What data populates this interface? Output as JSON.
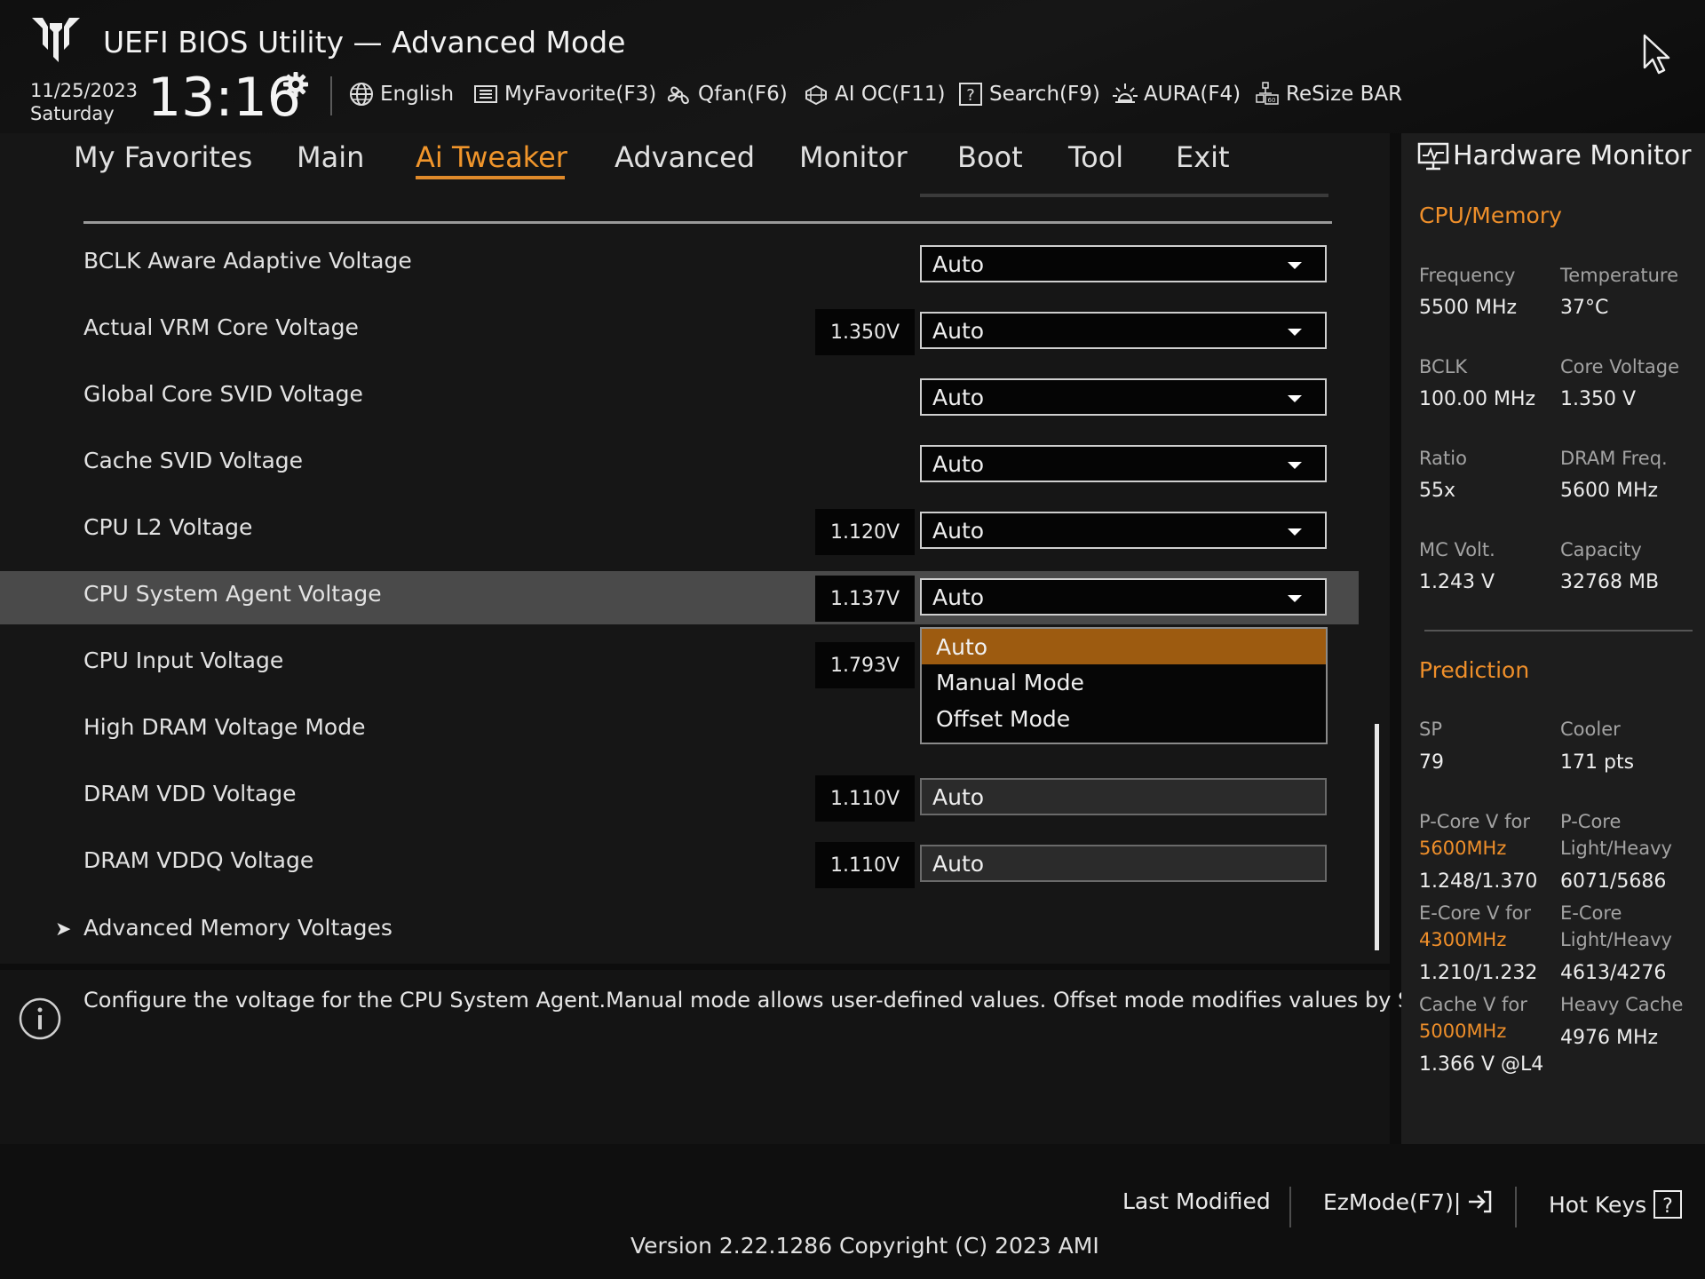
{
  "header": {
    "title": "UEFI BIOS Utility — Advanced Mode",
    "date": "11/25/2023",
    "day": "Saturday",
    "time": "13:16",
    "toolbar": {
      "language": "English",
      "my_favorite": "MyFavorite(F3)",
      "qfan": "Qfan(F6)",
      "ai_oc": "AI OC(F11)",
      "search": "Search(F9)",
      "aura": "AURA(F4)",
      "resize_bar": "ReSize BAR"
    }
  },
  "nav": {
    "tabs": [
      "My Favorites",
      "Main",
      "Ai Tweaker",
      "Advanced",
      "Monitor",
      "Boot",
      "Tool",
      "Exit"
    ],
    "active": "Ai Tweaker"
  },
  "settings": [
    {
      "label": "BCLK Aware Adaptive Voltage",
      "voltage": "",
      "value": "Auto"
    },
    {
      "label": "Actual VRM Core Voltage",
      "voltage": "1.350V",
      "value": "Auto"
    },
    {
      "label": "Global Core SVID Voltage",
      "voltage": "",
      "value": "Auto"
    },
    {
      "label": "Cache SVID Voltage",
      "voltage": "",
      "value": "Auto"
    },
    {
      "label": "CPU L2 Voltage",
      "voltage": "1.120V",
      "value": "Auto"
    },
    {
      "label": "CPU System Agent Voltage",
      "voltage": "1.137V",
      "value": "Auto"
    },
    {
      "label": "CPU Input Voltage",
      "voltage": "1.793V",
      "value": ""
    },
    {
      "label": "High DRAM Voltage Mode",
      "voltage": "",
      "value": ""
    },
    {
      "label": "DRAM VDD Voltage",
      "voltage": "1.110V",
      "value": "Auto"
    },
    {
      "label": "DRAM VDDQ Voltage",
      "voltage": "1.110V",
      "value": "Auto"
    },
    {
      "label": "Advanced Memory Voltages",
      "voltage": "",
      "value": ""
    }
  ],
  "dropdown": {
    "options": [
      "Auto",
      "Manual Mode",
      "Offset Mode"
    ],
    "selected": "Auto"
  },
  "help_text": "Configure the voltage for the CPU System Agent.Manual mode allows user-defined values. Offset mode modifies values by SVID.",
  "hardware_monitor": {
    "title": "Hardware Monitor",
    "cpu_memory": {
      "section": "CPU/Memory",
      "frequency_label": "Frequency",
      "frequency": "5500 MHz",
      "temperature_label": "Temperature",
      "temperature": "37°C",
      "bclk_label": "BCLK",
      "bclk": "100.00 MHz",
      "core_voltage_label": "Core Voltage",
      "core_voltage": "1.350 V",
      "ratio_label": "Ratio",
      "ratio": "55x",
      "dram_freq_label": "DRAM Freq.",
      "dram_freq": "5600 MHz",
      "mc_volt_label": "MC Volt.",
      "mc_volt": "1.243 V",
      "capacity_label": "Capacity",
      "capacity": "32768 MB"
    },
    "prediction": {
      "section": "Prediction",
      "sp_label": "SP",
      "sp": "79",
      "cooler_label": "Cooler",
      "cooler": "171 pts",
      "pcore_v_label": "P-Core V for",
      "pcore_v_freq": "5600MHz",
      "pcore_v": "1.248/1.370",
      "pcore_lh_label1": "P-Core",
      "pcore_lh_label2": "Light/Heavy",
      "pcore_lh": "6071/5686",
      "ecore_v_label": "E-Core V for",
      "ecore_v_freq": "4300MHz",
      "ecore_v": "1.210/1.232",
      "ecore_lh_label1": "E-Core",
      "ecore_lh_label2": "Light/Heavy",
      "ecore_lh": "4613/4276",
      "cache_v_label": "Cache V for",
      "cache_v_freq": "5000MHz",
      "cache_v": "1.366 V @L4",
      "heavy_cache_label": "Heavy Cache",
      "heavy_cache": "4976 MHz"
    }
  },
  "footer": {
    "last_modified": "Last Modified",
    "ezmode": "EzMode(F7)|",
    "hot_keys": "Hot Keys",
    "version": "Version 2.22.1286 Copyright (C) 2023 AMI"
  },
  "colors": {
    "accent": "#f0952b",
    "selected_option": "#9d5b10",
    "highlight_row": "#4a4a4a"
  }
}
